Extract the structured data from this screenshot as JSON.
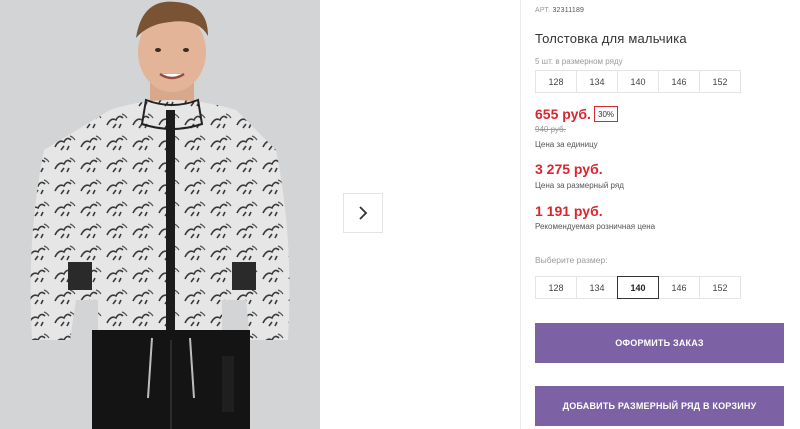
{
  "gallery": {
    "next_arrow": "chevron-right-icon"
  },
  "product": {
    "art_label": "АРТ.",
    "art_number": "32311189",
    "title": "Толстовка для мальчика",
    "pack_text": "5 шт. в размерном ряду",
    "pack_sizes": [
      "128",
      "134",
      "140",
      "146",
      "152"
    ],
    "price": "655 руб.",
    "discount": "30%",
    "old_price": "940 руб.",
    "unit_price_label": "Цена за единицу",
    "pack_price": "3 275 руб.",
    "pack_price_label": "Цена за размерный ряд",
    "retail_price": "1 191 руб.",
    "retail_price_label": "Рекомендуемая розничная цена",
    "choose_size_label": "Выберите размер:",
    "choose_sizes": [
      "128",
      "134",
      "140",
      "146",
      "152"
    ],
    "selected_size": "140",
    "order_button": "ОФОРМИТЬ ЗАКАЗ",
    "add_to_cart_button": "ДОБАВИТЬ РАЗМЕРНЫЙ РЯД В КОРЗИНУ"
  },
  "colors": {
    "price": "#d9262f",
    "button": "#7c62a4"
  }
}
